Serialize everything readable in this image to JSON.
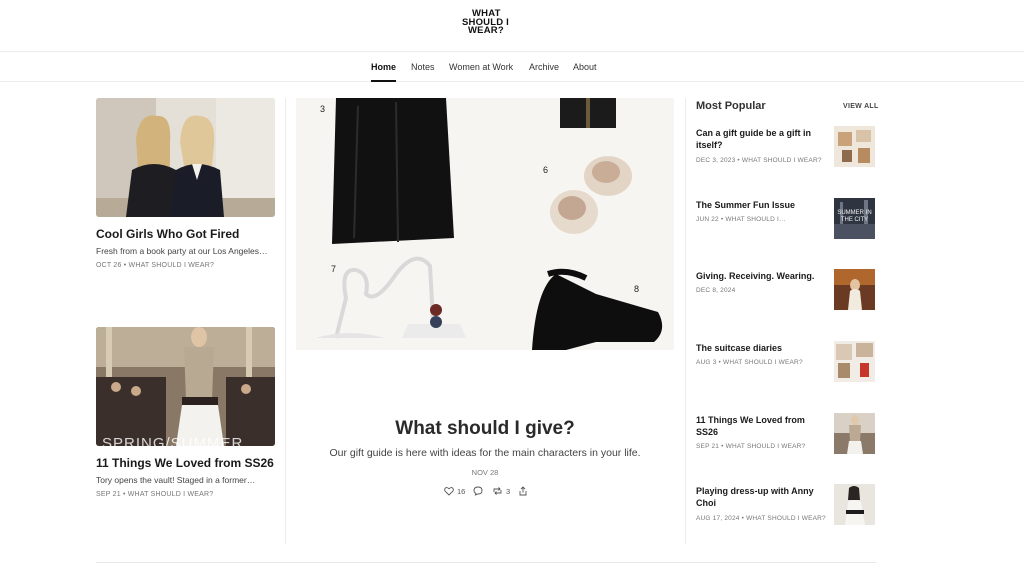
{
  "logo": {
    "line1": "WHAT",
    "line2": "SHOULD I",
    "line3": "WEAR?"
  },
  "nav": {
    "items": [
      {
        "label": "Home",
        "active": true
      },
      {
        "label": "Notes"
      },
      {
        "label": "Women at Work"
      },
      {
        "label": "Archive"
      },
      {
        "label": "About"
      }
    ]
  },
  "left_posts": [
    {
      "title": "Cool Girls Who Got Fired",
      "subtitle": "Fresh from a book party at our Los Angeles…",
      "meta": "OCT 26 • WHAT SHOULD I WEAR?"
    },
    {
      "title": "11 Things We Loved from SS26",
      "subtitle": "Tory opens the vault! Staged in a former…",
      "meta": "SEP 21 • WHAT SHOULD I WEAR?",
      "image_text": "SPRING/SUMMER"
    }
  ],
  "featured": {
    "title": "What should I give?",
    "subtitle": "Our gift guide is here with ideas for the main characters in your life.",
    "date": "NOV 28",
    "likes": "16",
    "restacks": "3",
    "image_numbers": [
      "3",
      "6",
      "7",
      "8"
    ]
  },
  "most_popular": {
    "heading": "Most Popular",
    "view_all": "VIEW ALL",
    "items": [
      {
        "title": "Can a gift guide be a gift in itself?",
        "meta": "DEC 3, 2023 • WHAT SHOULD I WEAR?"
      },
      {
        "title": "The Summer Fun Issue",
        "meta": "JUN 22 • WHAT SHOULD I…",
        "thumb_text": "SUMMER IN THE CITY"
      },
      {
        "title": "Giving. Receiving. Wearing.",
        "meta": "DEC 8, 2024"
      },
      {
        "title": "The suitcase diaries",
        "meta": "AUG 3 • WHAT SHOULD I WEAR?"
      },
      {
        "title": "11 Things We Loved from SS26",
        "meta": "SEP 21 • WHAT SHOULD I WEAR?"
      },
      {
        "title": "Playing dress-up with Anny Choi",
        "meta": "AUG 17, 2024 • WHAT SHOULD I WEAR?"
      }
    ]
  },
  "colors": {
    "accent_text": "#111111",
    "muted": "#777777",
    "divider": "#ececec"
  }
}
